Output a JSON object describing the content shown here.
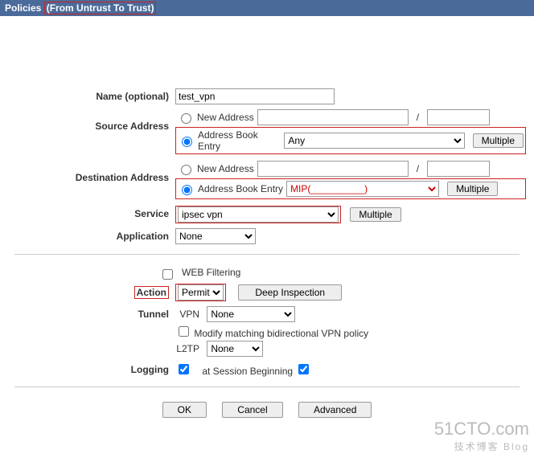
{
  "header": {
    "title": "Policies",
    "subtitle": "(From Untrust To Trust)"
  },
  "name": {
    "label": "Name (optional)",
    "value": "test_vpn"
  },
  "src": {
    "label": "Source Address",
    "newAddrLabel": "New Address",
    "newAddrValue": "",
    "maskValue": "",
    "bookLabel": "Address Book Entry",
    "bookValue": "Any",
    "multipleBtn": "Multiple"
  },
  "dst": {
    "label": "Destination Address",
    "newAddrLabel": "New Address",
    "newAddrValue": "",
    "maskValue": "",
    "bookLabel": "Address Book Entry",
    "bookValue": "MIP(__________)",
    "multipleBtn": "Multiple"
  },
  "service": {
    "label": "Service",
    "value": "ipsec vpn",
    "multipleBtn": "Multiple"
  },
  "application": {
    "label": "Application",
    "value": "None"
  },
  "webfilter": {
    "label": "WEB Filtering"
  },
  "action": {
    "label": "Action",
    "value": "Permit",
    "deepBtn": "Deep Inspection"
  },
  "tunnel": {
    "label": "Tunnel",
    "vpnLabel": "VPN",
    "vpnValue": "None",
    "modifyLabel": "Modify matching bidirectional VPN policy",
    "l2tpLabel": "L2TP",
    "l2tpValue": "None"
  },
  "logging": {
    "label": "Logging",
    "sessionLabel": "at Session Beginning"
  },
  "buttons": {
    "ok": "OK",
    "cancel": "Cancel",
    "advanced": "Advanced"
  },
  "watermark": {
    "main": "51CTO.com",
    "sub": "技术博客  Blog"
  }
}
